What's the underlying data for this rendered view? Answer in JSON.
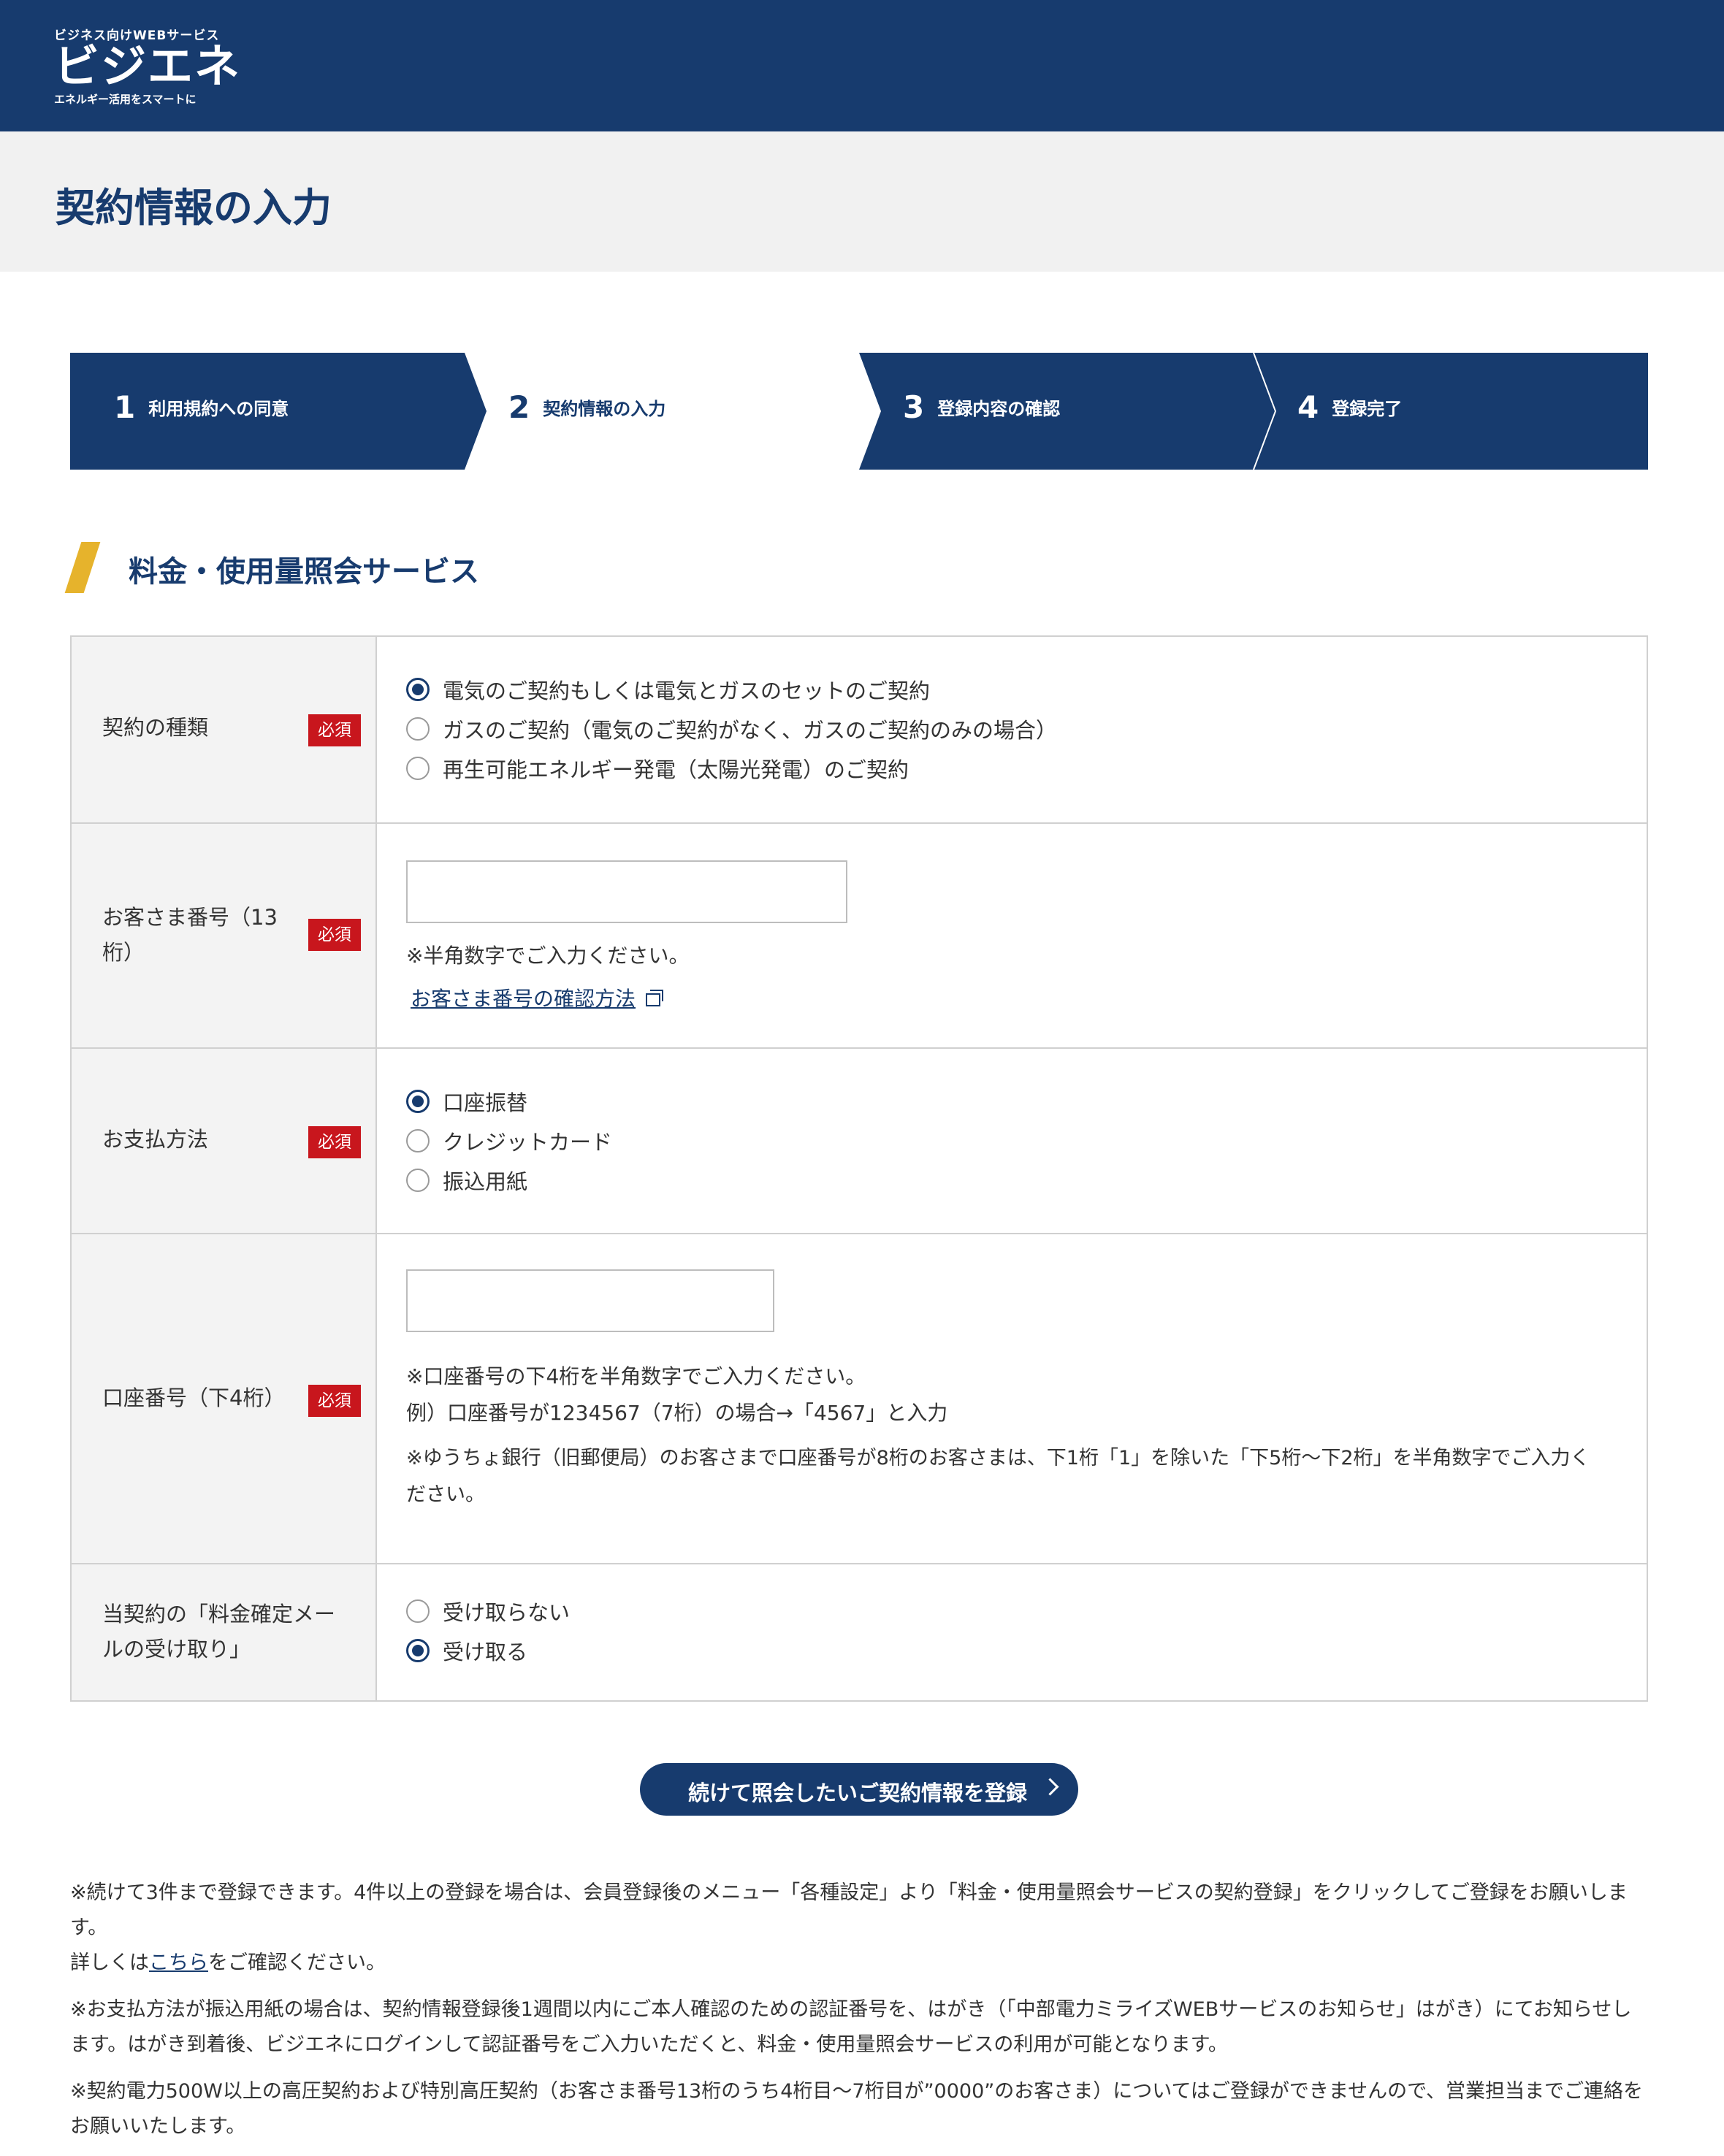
{
  "header": {
    "logo_tagline": "ビジネス向けWEBサービス",
    "logo_name": "ビジエネ",
    "logo_subline": "エネルギー活用をスマートに",
    "bg_color": "#173b6e"
  },
  "page_title": "契約情報の入力",
  "steps": [
    {
      "num": "1",
      "label": "利用規約への同意",
      "active": false
    },
    {
      "num": "2",
      "label": "契約情報の入力",
      "active": true
    },
    {
      "num": "3",
      "label": "登録内容の確認",
      "active": false
    },
    {
      "num": "4",
      "label": "登録完了",
      "active": false
    }
  ],
  "section_title": "料金・使用量照会サービス",
  "required_badge": "必須",
  "form": {
    "contract_type": {
      "label": "契約の種類",
      "options": [
        {
          "label": "電気のご契約もしくは電気とガスのセットのご契約",
          "checked": true
        },
        {
          "label": "ガスのご契約（電気のご契約がなく、ガスのご契約のみの場合）",
          "checked": false
        },
        {
          "label": "再生可能エネルギー発電（太陽光発電）のご契約",
          "checked": false
        }
      ]
    },
    "customer_number": {
      "label": "お客さま番号（13桁）",
      "value": "",
      "note": "※半角数字でご入力ください。",
      "link": "お客さま番号の確認方法"
    },
    "payment_method": {
      "label": "お支払方法",
      "options": [
        {
          "label": "口座振替",
          "checked": true
        },
        {
          "label": "クレジットカード",
          "checked": false
        },
        {
          "label": "振込用紙",
          "checked": false
        }
      ]
    },
    "account_number": {
      "label": "口座番号（下4桁）",
      "value": "",
      "note1": "※口座番号の下4桁を半角数字でご入力ください。",
      "note2": "例）口座番号が1234567（7桁）の場合→「4567」と入力",
      "note3a": "※ゆうちょ銀行（旧郵便局）のお客さまで口座番号が8桁のお客さまは、下1桁「1」を除いた「下5桁～下2桁」を半角数字でご入力く",
      "note3b": "ださい。"
    },
    "mail_receipt": {
      "label": "当契約の「料金確定メールの受け取り」",
      "options": [
        {
          "label": "受け取らない",
          "checked": false
        },
        {
          "label": "受け取る",
          "checked": true
        }
      ]
    }
  },
  "submit_button": "続けて照会したいご契約情報を登録",
  "footnotes": {
    "p1a": "※続けて3件まで登録できます。4件以上の登録を場合は、会員登録後のメニュー「各種設定」より「料金・使用量照会サービスの契約登録」をクリックしてご登録をお願いします。",
    "p1b_pre": "詳しくは",
    "p1b_link": "こちら",
    "p1b_post": "をご確認ください。",
    "p2": "※お支払方法が振込用紙の場合は、契約情報登録後1週間以内にご本人確認のための認証番号を、はがき（「中部電力ミライズWEBサービスのお知らせ」はがき）にてお知らせします。はがき到着後、ビジエネにログインして認証番号をご入力いただくと、料金・使用量照会サービスの利用が可能となります。",
    "p3": "※契約電力500W以上の高圧契約および特別高圧契約（お客さま番号13桁のうち4桁目～7桁目が”0000”のお客さま）についてはご登録ができませんので、営業担当までご連絡をお願いいたします。"
  }
}
